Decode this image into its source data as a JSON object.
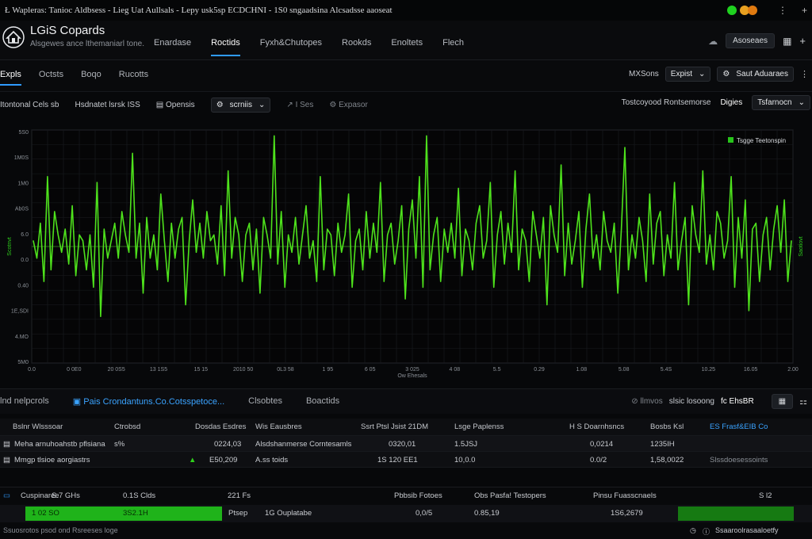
{
  "titlebar": {
    "title": "Ł Wapleras: Tanioc Aldbsess  -  Lieg Uat Aullsals  -  Lepy  usk5sp ECDCHNI  -  1S0  sngaadsina  Alcsadsse  aaoseat",
    "dot_colors": [
      "#1fd11f",
      "#e8a020",
      "#e07a10"
    ]
  },
  "header": {
    "brand": "LGiS Copards",
    "tagline": "Alsgewes ance lthemaniarl tone.",
    "nav": [
      "Enardase",
      "Roctids",
      "Fyxh&Chutopes",
      "Rookds",
      "Enoltets",
      "Flech"
    ],
    "active_nav": 1,
    "right_button": "Asoseaes"
  },
  "subbar": {
    "tabs": [
      "Expls",
      "Octsts",
      "Boqo",
      "Rucotts"
    ],
    "active_tab": 0,
    "label_left": "MXSons",
    "select1": "Expist",
    "select2": "Saut Aduaraes"
  },
  "toolbar": {
    "label1": "Itontonal Cels sb",
    "label2": "Hsdnatet lsrsk ISS",
    "open_label": "Opensis",
    "dropdown": "scrniis",
    "muted1": "I Ses",
    "muted2": "Expasor",
    "right_label": "Tostcoyood Rontsemorse",
    "right_value": "Digies",
    "right_select": "Tsfarnocn"
  },
  "chart_data": {
    "type": "line",
    "title": "",
    "xlabel": "Ow Ehesals",
    "ylabel_right": "Saotiovt",
    "ylabel_left": "Scotnvt",
    "y_ticks": [
      "5S0",
      "1M0S",
      "1M0",
      "Ab0S",
      "6.0",
      "0.0",
      "0.40",
      "1E,SDI",
      "4.MO",
      "5M0"
    ],
    "x_ticks": [
      "0.0",
      "0 0E0",
      "20 0S5",
      "13 1S5",
      "15 15",
      "2010 50",
      "0L3 58",
      "1 95",
      "6 05",
      "3 025",
      "4 08",
      "5.5",
      "0.29",
      "1.08",
      "5.08",
      "5.4S",
      "10.25",
      "16.05",
      "2.00"
    ],
    "legend": "Tsgge Teetonspin",
    "legend_color": "#27c41a",
    "line_color": "#4ee21c",
    "series": [
      {
        "values": [
          0.05,
          -0.1,
          0.2,
          -0.3,
          0.6,
          -0.2,
          0.3,
          0.1,
          -0.05,
          0.15,
          -0.15,
          0.35,
          -0.25,
          0.1,
          0.05,
          -0.2,
          0.1,
          -0.35,
          0.55,
          -0.6,
          0.15,
          -0.1,
          0.05,
          0.2,
          -0.1,
          0.3,
          0.1,
          -0.05,
          0.8,
          -0.1,
          0.2,
          -0.4,
          0.25,
          -0.1,
          0.1,
          -0.2,
          0.45,
          0.05,
          -0.3,
          0.2,
          -0.1,
          0.15,
          0.25,
          -0.5,
          0.05,
          0.4,
          -0.05,
          0.2,
          -0.1,
          0.3,
          0.05,
          0.1,
          -0.15,
          0.35,
          -0.25,
          0.65,
          -0.1,
          0.25,
          0.1,
          -0.3,
          0.1,
          0.2,
          -0.2,
          0.15,
          -0.4,
          0.25,
          0.1,
          -0.1,
          0.95,
          -0.15,
          0.3,
          -0.35,
          0.1,
          -0.05,
          0.25,
          -0.15,
          0.1,
          0.35,
          -0.1,
          0.05,
          -0.3,
          0.6,
          -0.2,
          0.15,
          0.1,
          -0.25,
          0.2,
          -0.05,
          0.1,
          0.45,
          -0.35,
          0.05,
          0.15,
          -0.2,
          0.3,
          -0.1,
          0.2,
          -0.05,
          0.55,
          -0.3,
          0.1,
          0.2,
          -0.15,
          0.05,
          0.35,
          -0.45,
          0.15,
          0.4,
          -0.1,
          0.6,
          -0.35,
          0.95,
          -0.2,
          0.1,
          0.25,
          -0.3,
          0.15,
          -0.05,
          0.2,
          -0.1,
          0.5,
          -0.25,
          0.15,
          0.05,
          -0.2,
          0.2,
          0.35,
          -0.1,
          0.05,
          0.55,
          -0.35,
          0.1,
          0.3,
          -0.15,
          0.2,
          -0.05,
          0.65,
          -0.2,
          0.15,
          0.05,
          -0.3,
          0.3,
          0.1,
          -0.1,
          0.25,
          -0.5,
          0.35,
          0.1,
          -0.05,
          0.7,
          -0.25,
          0.2,
          -0.15,
          0.05,
          0.3,
          -0.35,
          0.15,
          0.45,
          -0.1,
          0.1,
          -0.2,
          0.3,
          0.05,
          -0.05,
          0.2,
          -0.4,
          0.15,
          0.85,
          -0.2,
          0.1,
          -0.1,
          0.25,
          0.05,
          -0.3,
          0.45,
          -0.15,
          0.2,
          0.3,
          -0.25,
          0.1,
          -0.1,
          0.55,
          -0.2,
          0.05,
          0.25,
          -0.5,
          0.35,
          0.1,
          -0.05,
          0.65,
          -0.15,
          0.1,
          -0.2,
          0.3,
          0.2,
          -0.1,
          0.05,
          0.6,
          -0.35,
          0.25,
          -0.1,
          0.4,
          -0.55,
          0.15,
          0.2,
          -0.3,
          0.1,
          0.25,
          -0.2,
          0.15,
          0.35,
          -0.05,
          0.4,
          -0.3,
          0.05
        ]
      }
    ],
    "ylim": [
      -1.0,
      1.0
    ],
    "grid": true
  },
  "tablebar": {
    "tabs": [
      "lnd nelpcrols",
      "Pais Crondantuns.Co.Cotsspetoce...",
      "Clsobtes",
      "Boactids"
    ],
    "active_tab": 1,
    "right_muted": "llmvos",
    "right_label": "slsic losoong",
    "right_value": "fc EhsBR"
  },
  "table": {
    "headers": [
      "Bslnr Wlsssoar",
      "Ctrobsd",
      "Dosdas Esdres",
      "Wis Eausbres",
      "Ssrt Ptsl Jsist 21DM",
      "Lsge Paplenss",
      "H S  Doarnhsncs",
      "Bosbs Ksl",
      "ES Frasf&EIB  Co"
    ],
    "rows": [
      [
        "Meha arnuhoahstb pflsiana",
        "s%",
        "0224,03",
        "Alsdshanmerse Corntesamls",
        "0320,01",
        "1.5JSJ",
        "0,0214",
        "1235IH",
        ""
      ],
      [
        "Mmgp tlsioe aorgiastrs",
        "",
        "E50,209",
        "A.ss toids",
        "1S 120 EE1",
        "10,0.0",
        "0.0/2",
        "1,58,0022",
        "Slssdoesessoints"
      ]
    ]
  },
  "footer": {
    "row1": [
      "Cuspinaree",
      "S.7 GHs",
      "0.1S Clds",
      "221 Fs",
      "Pbbsib Fotoes",
      "Obs Pasfa! Testopers",
      "Pinsu Fuasscnaels",
      "S l2"
    ],
    "row2": [
      "1 02 SO",
      "3S2.1H",
      "Ptsep",
      "1G Ouplatabe",
      "0,0/5",
      "0.85,19",
      "1S6,2679"
    ],
    "status": "Ssuosrotos psod ond Rsreeses loge",
    "status_right": "Ssaaroolrasaaloetfy"
  }
}
